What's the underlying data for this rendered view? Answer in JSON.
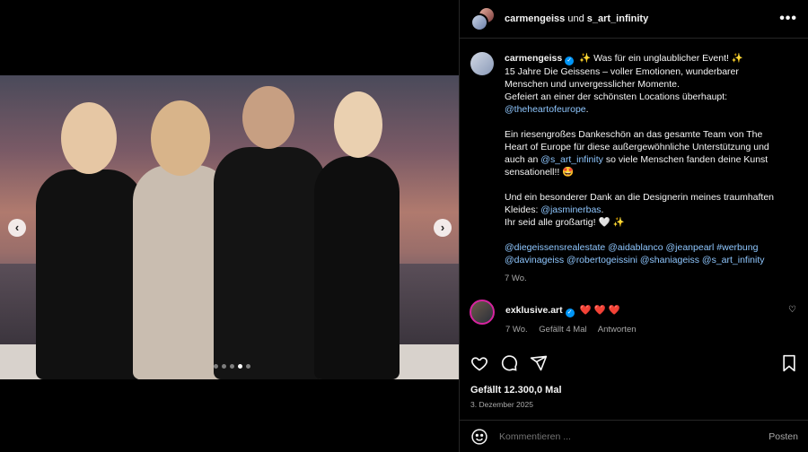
{
  "header": {
    "user1": "carmengeiss",
    "joiner": "und",
    "user2": "s_art_infinity",
    "more": "•••"
  },
  "carousel": {
    "prev": "‹",
    "next": "›",
    "slide_count": 5,
    "active_index": 3
  },
  "caption": {
    "username": "carmengeiss",
    "verified_glyph": "✓",
    "line1": "✨ Was für ein unglaublicher Event! ✨",
    "line2": "15 Jahre Die Geissens – voller Emotionen, wunderbarer Menschen und unvergesslicher Momente.",
    "line3": "Gefeiert an einer der schönsten Locations überhaupt:",
    "link1": "@theheartofeurope",
    "link1_after": ".",
    "para2_a": "Ein riesengroßes Dankeschön an das gesamte Team von The Heart of Europe für diese außergewöhnliche Unterstützung und auch an",
    "link2": "@s_art_infinity",
    "para2_b": "so viele Menschen fanden deine Kunst sensationell!! 🤩",
    "para3_a": "Und ein besonderer Dank an die Designerin meines traumhaften Kleides:",
    "link3": "@jasminerbas",
    "para3_b": ".",
    "para3_c": "Ihr seid alle großartig! 🤍 ✨",
    "tags": "@diegeissensrealestate @aidablanco @jeanpearl #werbung @davinageiss @robertogeissini @shaniageiss @s_art_infinity",
    "age": "7 Wo."
  },
  "comment": {
    "username": "exklusive.art",
    "verified_glyph": "✓",
    "text": "❤️ ❤️ ❤️",
    "age": "7 Wo.",
    "likes": "Gefällt 4 Mal",
    "reply": "Antworten",
    "like_icon": "♡"
  },
  "footer": {
    "likes": "Gefällt 12.300,0 Mal",
    "date": "3. Dezember 2025",
    "comment_placeholder": "Kommentieren ...",
    "post": "Posten"
  }
}
